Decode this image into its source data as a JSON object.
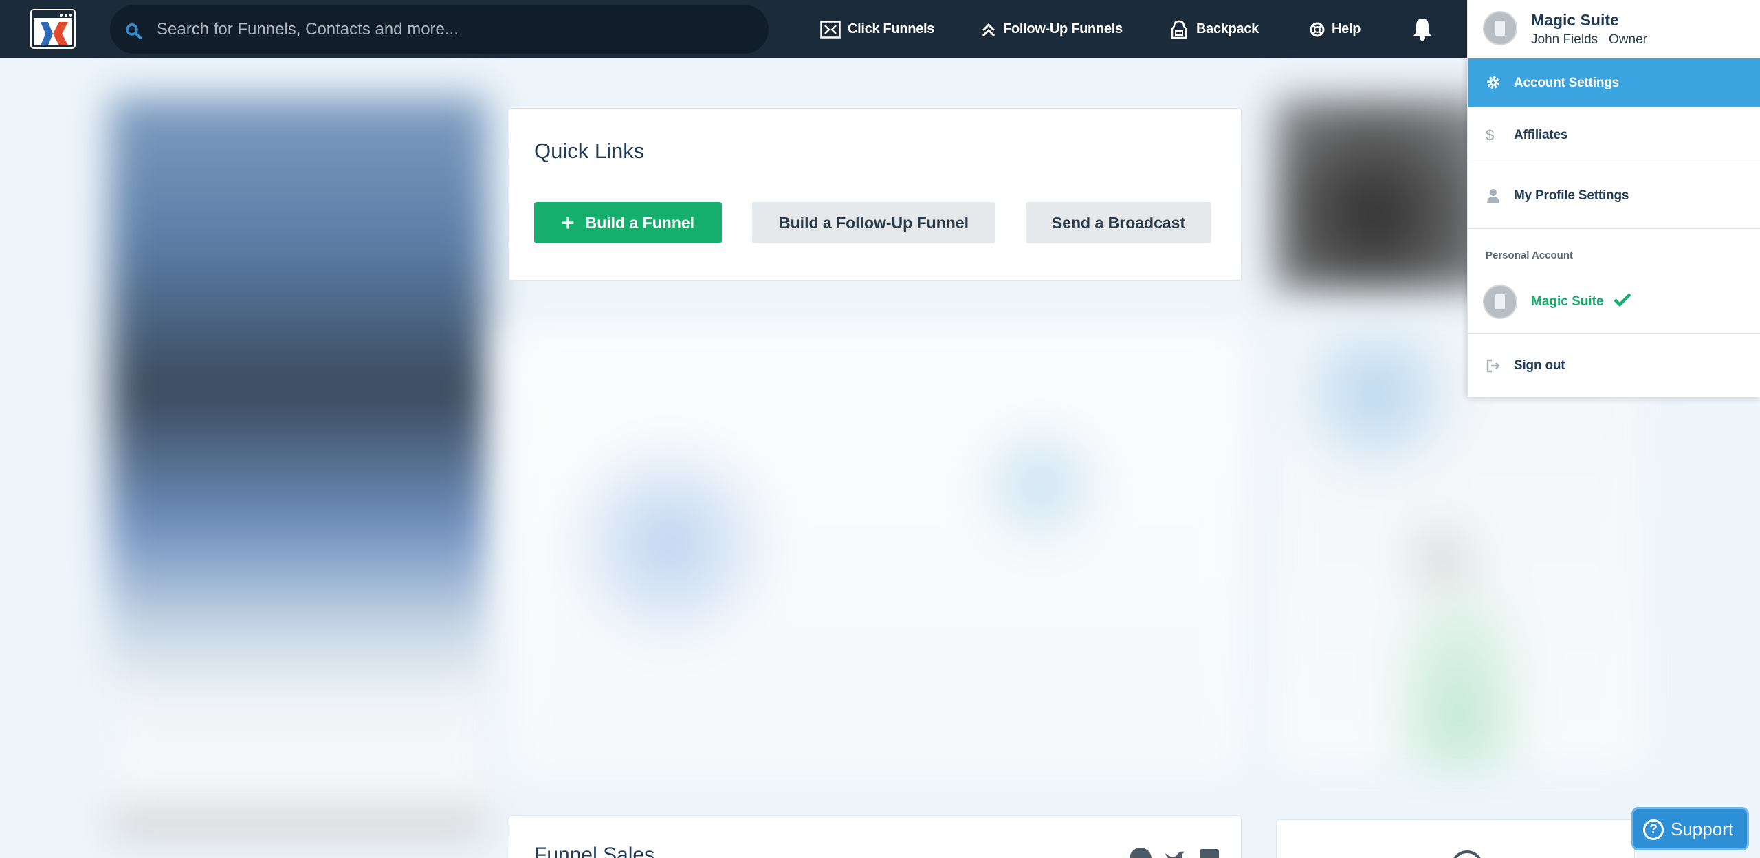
{
  "nav": {
    "search_placeholder": "Search for Funnels, Contacts and more...",
    "links": [
      {
        "label": "Click Funnels",
        "icon": "clickfunnels-icon"
      },
      {
        "label": "Follow-Up Funnels",
        "icon": "double-chevron-up-icon"
      },
      {
        "label": "Backpack",
        "icon": "backpack-icon"
      },
      {
        "label": "Help",
        "icon": "lifebuoy-icon"
      }
    ],
    "notifications_icon": "bell-icon"
  },
  "quick_links": {
    "title": "Quick Links",
    "buttons": {
      "build_funnel": "Build a Funnel",
      "build_followup": "Build a Follow-Up Funnel",
      "send_broadcast": "Send a Broadcast"
    }
  },
  "funnel_sales": {
    "title": "Funnel Sales"
  },
  "account_menu": {
    "account_name": "Magic Suite",
    "user_name": "John Fields",
    "role": "Owner",
    "items": {
      "account_settings": "Account Settings",
      "affiliates": "Affiliates",
      "profile_settings": "My Profile Settings",
      "sign_out": "Sign out"
    },
    "section_label": "Personal Account",
    "personal_account": "Magic Suite"
  },
  "support": {
    "label": "Support"
  },
  "colors": {
    "navbar": "#1c2b3a",
    "primary_green": "#16ae6c",
    "active_blue": "#3ba3e0",
    "support_blue": "#2d8fd6",
    "page_bg": "#eef5fb"
  }
}
